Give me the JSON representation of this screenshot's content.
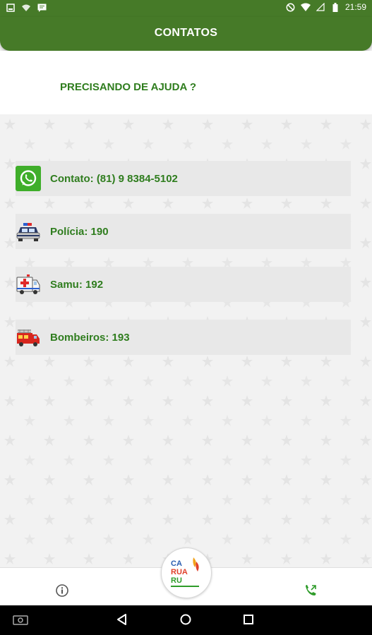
{
  "status_bar": {
    "time": "21:59"
  },
  "app_bar": {
    "title": "CONTATOS"
  },
  "help_text": "PRECISANDO DE AJUDA ?",
  "contacts": [
    {
      "label": "Contato: (81) 9 8384-5102",
      "icon": "whatsapp-icon"
    },
    {
      "label": "Polícia: 190",
      "icon": "police-car-icon"
    },
    {
      "label": "Samu: 192",
      "icon": "ambulance-icon"
    },
    {
      "label": "Bombeiros: 193",
      "icon": "fire-truck-icon"
    }
  ],
  "logo": {
    "lines": [
      "CA",
      "RUA",
      "RU"
    ]
  },
  "bottom_nav": {
    "left_icon": "info-icon",
    "right_icon": "phone-call-icon"
  },
  "colors": {
    "primary": "#467a28",
    "text_green": "#2f7d1e",
    "item_bg": "#e8e8e8"
  }
}
